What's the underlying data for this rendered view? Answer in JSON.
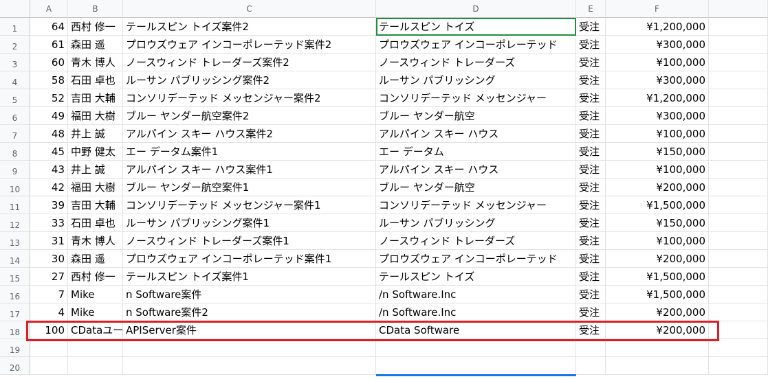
{
  "columns": [
    "A",
    "B",
    "C",
    "D",
    "E",
    "F"
  ],
  "rows": [
    {
      "num": "1",
      "a": "64",
      "b": "西村 修一",
      "c": "テールスピン トイズ案件2",
      "d": "テールスピン トイズ",
      "e": "受注",
      "f": "¥1,200,000"
    },
    {
      "num": "2",
      "a": "61",
      "b": "森田 遥",
      "c": "プロウズウェア インコーポレーテッド案件2",
      "d": "プロウズウェア インコーポレーテッド",
      "e": "受注",
      "f": "¥300,000"
    },
    {
      "num": "3",
      "a": "60",
      "b": "青木 博人",
      "c": "ノースウィンド トレーダーズ案件2",
      "d": "ノースウィンド トレーダーズ",
      "e": "受注",
      "f": "¥100,000"
    },
    {
      "num": "4",
      "a": "58",
      "b": "石田 卓也",
      "c": "ルーサン パブリッシング案件2",
      "d": "ルーサン パブリッシング",
      "e": "受注",
      "f": "¥300,000"
    },
    {
      "num": "5",
      "a": "52",
      "b": "吉田 大輔",
      "c": "コンソリデーテッド メッセンジャー案件2",
      "d": "コンソリデーテッド メッセンジャー",
      "e": "受注",
      "f": "¥1,200,000"
    },
    {
      "num": "6",
      "a": "49",
      "b": "福田 大樹",
      "c": "ブルー ヤンダー航空案件2",
      "d": "ブルー ヤンダー航空",
      "e": "受注",
      "f": "¥300,000"
    },
    {
      "num": "7",
      "a": "48",
      "b": "井上 誠",
      "c": "アルパイン スキー ハウス案件2",
      "d": "アルパイン スキー ハウス",
      "e": "受注",
      "f": "¥100,000"
    },
    {
      "num": "8",
      "a": "45",
      "b": "中野 健太",
      "c": "エー データム案件1",
      "d": "エー データム",
      "e": "受注",
      "f": "¥150,000"
    },
    {
      "num": "9",
      "a": "43",
      "b": "井上 誠",
      "c": "アルパイン スキー ハウス案件1",
      "d": "アルパイン スキー ハウス",
      "e": "受注",
      "f": "¥100,000"
    },
    {
      "num": "10",
      "a": "42",
      "b": "福田 大樹",
      "c": "ブルー ヤンダー航空案件1",
      "d": "ブルー ヤンダー航空",
      "e": "受注",
      "f": "¥200,000"
    },
    {
      "num": "11",
      "a": "39",
      "b": "吉田 大輔",
      "c": "コンソリデーテッド メッセンジャー案件1",
      "d": "コンソリデーテッド メッセンジャー",
      "e": "受注",
      "f": "¥1,500,000"
    },
    {
      "num": "12",
      "a": "33",
      "b": "石田 卓也",
      "c": "ルーサン パブリッシング案件1",
      "d": "ルーサン パブリッシング",
      "e": "受注",
      "f": "¥150,000"
    },
    {
      "num": "13",
      "a": "31",
      "b": "青木 博人",
      "c": "ノースウィンド トレーダーズ案件1",
      "d": "ノースウィンド トレーダーズ",
      "e": "受注",
      "f": "¥100,000"
    },
    {
      "num": "14",
      "a": "30",
      "b": "森田 遥",
      "c": "プロウズウェア インコーポレーテッド案件1",
      "d": "プロウズウェア インコーポレーテッド",
      "e": "受注",
      "f": "¥200,000"
    },
    {
      "num": "15",
      "a": "27",
      "b": "西村 修一",
      "c": "テールスピン トイズ案件1",
      "d": "テールスピン トイズ",
      "e": "受注",
      "f": "¥1,500,000"
    },
    {
      "num": "16",
      "a": "7",
      "b": "Mike",
      "c": "n Software案件",
      "d": "/n Software.Inc",
      "e": "受注",
      "f": "¥1,500,000"
    },
    {
      "num": "17",
      "a": "4",
      "b": "Mike",
      "c": "n Software案件2",
      "d": "/n Software.Inc",
      "e": "受注",
      "f": "¥200,000"
    },
    {
      "num": "18",
      "a": "100",
      "b": "CDataユーザー",
      "c": "APIServer案件",
      "d": "CData Software",
      "e": "受注",
      "f": "¥200,000"
    },
    {
      "num": "19",
      "a": "",
      "b": "",
      "c": "",
      "d": "",
      "e": "",
      "f": ""
    },
    {
      "num": "20",
      "a": "",
      "b": "",
      "c": "",
      "d": "",
      "e": "",
      "f": ""
    }
  ],
  "selection": {
    "cell": "D1"
  },
  "highlight": {
    "row": "18",
    "color": "#e01b24"
  }
}
